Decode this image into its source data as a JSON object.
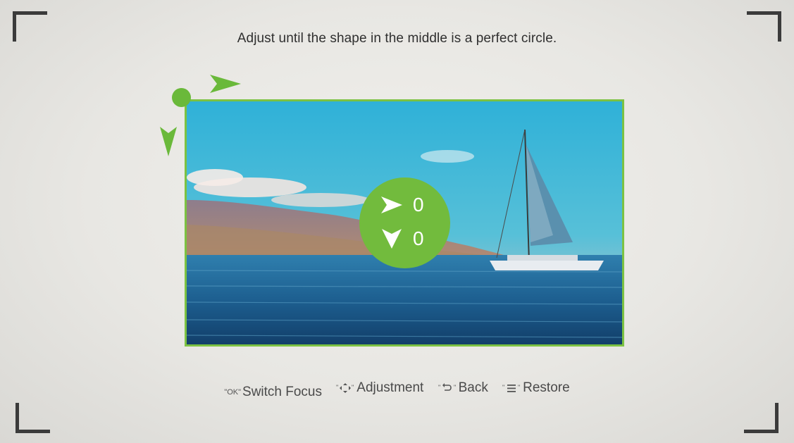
{
  "instruction": "Adjust until the shape in the middle is a perfect circle.",
  "offsets": {
    "horizontal": "0",
    "vertical": "0"
  },
  "help": {
    "switch_focus": {
      "key": "\"OK\"",
      "label": "Switch Focus"
    },
    "adjustment": {
      "key_icon": "directional-pad-icon",
      "label": "Adjustment"
    },
    "back": {
      "key_icon": "back-icon",
      "label": "Back"
    },
    "restore": {
      "key_icon": "menu-icon",
      "label": "Restore"
    }
  },
  "colors": {
    "accent": "#72bb3d",
    "frame": "#7cc242",
    "corner": "#3b3b3b"
  }
}
